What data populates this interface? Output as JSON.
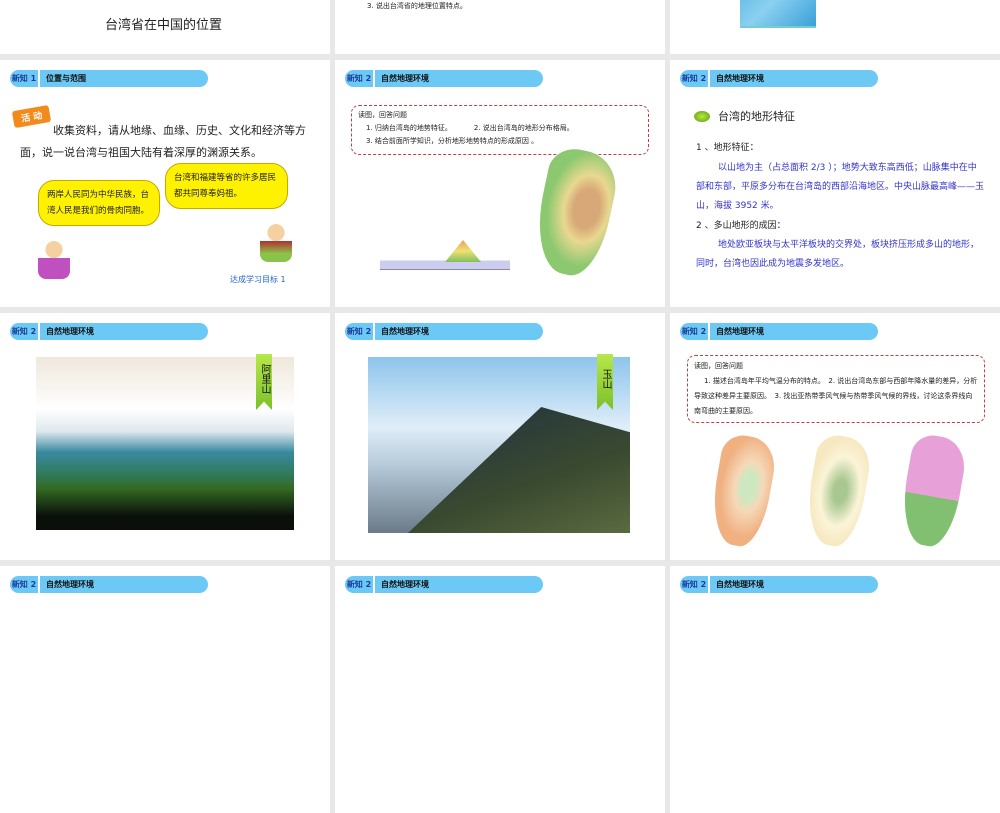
{
  "slides": [
    {
      "title": "台湾省在中国的位置"
    },
    {
      "question": "3. 说出台湾省的地理位置特点。"
    },
    {},
    {
      "tag": "新知 1",
      "header": "位置与范围",
      "activity": "活 动",
      "body": "收集资料，请从地缘、血缘、历史、文化和经济等方面，说一说台湾与祖国大陆有着深厚的渊源关系。",
      "bubble_left": "两岸人民同为中华民族，台湾人民是我们的骨肉同胞。",
      "bubble_right": "台湾和福建等省的许多居民都共同尊奉妈祖。",
      "goal": "达成学习目标 1"
    },
    {
      "tag": "新知 2",
      "header": "自然地理环境",
      "box_title": "读图，回答问题",
      "q1": "1. 归纳台湾岛的地势特征。",
      "q2": "2. 说出台湾岛的地形分布格局。",
      "q3": "3. 结合前面所学知识，分析地形地势特点的形成原因 。"
    },
    {
      "tag": "新知 2",
      "header": "自然地理环境",
      "subtitle": "台湾的地形特征",
      "h1": "1 、地形特征：",
      "p1": "以山地为主（占总面积 2/3 ）；地势大致东高西低；山脉集中在中部和东部，平原多分布在台湾岛的西部沿海地区。中央山脉最高峰——玉山，海拔 3952 米。",
      "h2": "2 、多山地形的成因：",
      "p2": "地处欧亚板块与太平洋板块的交界处，板块挤压形成多山的地形，同时，台湾也因此成为地震多发地区。"
    },
    {
      "tag": "新知 2",
      "header": "自然地理环境",
      "label": "阿里山"
    },
    {
      "tag": "新知 2",
      "header": "自然地理环境",
      "label": "玉山"
    },
    {
      "tag": "新知 2",
      "header": "自然地理环境",
      "box_title": "读图，回答问题",
      "body": "1. 描述台湾岛年平均气温分布的特点。　2. 说出台湾岛东部与西部年降水量的差异，分析导致这种差异主要原因。　3. 找出亚热带季风气候与热带季风气候的界线，讨论这条界线向南弯曲的主要原因。"
    },
    {
      "tag": "新知 2",
      "header": "自然地理环境"
    },
    {
      "tag": "新知 2",
      "header": "自然地理环境"
    },
    {
      "tag": "新知 2",
      "header": "自然地理环境"
    }
  ]
}
